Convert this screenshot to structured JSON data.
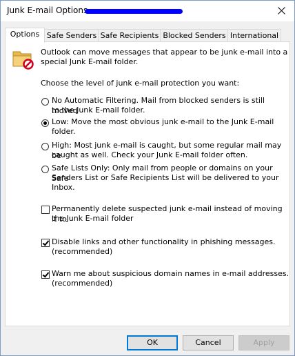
{
  "window": {
    "title": "Junk E-mail Options - ",
    "close_icon": "close-icon"
  },
  "tabs": [
    {
      "label": "Options",
      "active": true
    },
    {
      "label": "Safe Senders",
      "active": false
    },
    {
      "label": "Safe Recipients",
      "active": false
    },
    {
      "label": "Blocked Senders",
      "active": false
    },
    {
      "label": "International",
      "active": false
    }
  ],
  "options": {
    "intro_line1": "Outlook can move messages that appear to be junk e-mail into a",
    "intro_line2": "special Junk E-mail folder.",
    "level_prompt": "Choose the level of junk e-mail protection you want:",
    "radios": [
      {
        "lines": [
          "No Automatic Filtering. Mail from blocked senders is still moved",
          "to the Junk E-mail folder."
        ],
        "checked": false
      },
      {
        "lines": [
          "Low: Move the most obvious junk e-mail to the Junk E-mail",
          "folder."
        ],
        "checked": true
      },
      {
        "lines": [
          "High: Most junk e-mail is caught, but some regular mail may be",
          "caught as well. Check your Junk E-mail folder often."
        ],
        "checked": false
      },
      {
        "lines": [
          "Safe Lists Only: Only mail from people or domains on your Safe",
          "Senders List or Safe Recipients List will be delivered to your",
          "Inbox."
        ],
        "checked": false
      }
    ],
    "checkboxes": [
      {
        "lines": [
          "Permanently delete suspected junk e-mail instead of moving it to",
          "the Junk E-mail folder"
        ],
        "checked": false
      },
      {
        "lines": [
          "Disable links and other functionality in phishing messages.",
          "(recommended)"
        ],
        "checked": true
      },
      {
        "lines": [
          "Warn me about suspicious domain names in e-mail addresses.",
          "(recommended)"
        ],
        "checked": true
      }
    ]
  },
  "buttons": {
    "ok": "OK",
    "cancel": "Cancel",
    "apply": "Apply"
  },
  "icons": {
    "folder": "junk-folder-icon"
  }
}
